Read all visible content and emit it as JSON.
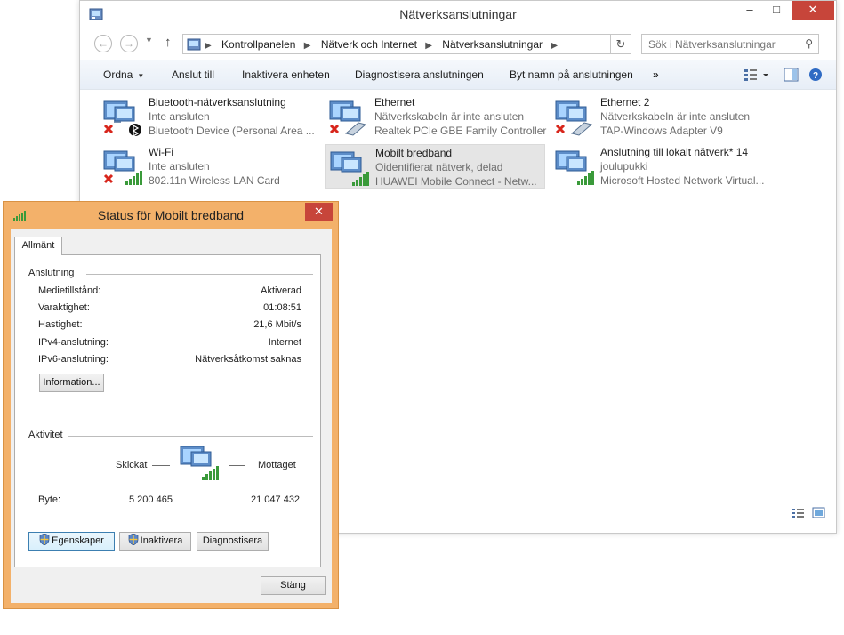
{
  "main_window": {
    "title": "Nätverksanslutningar",
    "caption": {
      "minimize": "–",
      "maximize": "□",
      "close": "✕"
    },
    "breadcrumbs": [
      "Kontrollpanelen",
      "Nätverk och Internet",
      "Nätverksanslutningar"
    ],
    "search_placeholder": "Sök i Nätverksanslutningar",
    "toolbar": {
      "organize": "Ordna",
      "connect_to": "Anslut till",
      "disable": "Inaktivera enheten",
      "diagnose": "Diagnostisera anslutningen",
      "rename": "Byt namn på anslutningen",
      "more": "»"
    },
    "adapters": [
      {
        "name": "Bluetooth-nätverksanslutning",
        "status": "Inte ansluten",
        "device": "Bluetooth Device (Personal Area ...",
        "icon": "bluetooth-network-icon",
        "badge": "bluetooth"
      },
      {
        "name": "Ethernet",
        "status": "Nätverkskabeln är inte ansluten",
        "device": "Realtek PCIe GBE Family Controller",
        "icon": "ethernet-network-icon",
        "badge": "cable"
      },
      {
        "name": "Ethernet 2",
        "status": "Nätverkskabeln är inte ansluten",
        "device": "TAP-Windows Adapter V9",
        "icon": "ethernet-network-icon",
        "badge": "cable"
      },
      {
        "name": "Wi-Fi",
        "status": "Inte ansluten",
        "device": "802.11n Wireless LAN Card",
        "icon": "wifi-network-icon",
        "badge": "signal"
      },
      {
        "name": "Mobilt bredband",
        "status": "Oidentifierat nätverk, delad",
        "device": "HUAWEI Mobile Connect - Netw...",
        "icon": "mobile-broadband-icon",
        "badge": "signal"
      },
      {
        "name": "Anslutning till lokalt nätverk* 14",
        "status": "joulupukki",
        "device": "Microsoft Hosted Network Virtual...",
        "icon": "hosted-network-icon",
        "badge": "signal"
      }
    ]
  },
  "dialog": {
    "title": "Status för Mobilt bredband",
    "close": "✕",
    "tab": "Allmänt",
    "connection_group": "Anslutning",
    "rows": [
      {
        "key": "Medietillstånd:",
        "value": "Aktiverad"
      },
      {
        "key": "Varaktighet:",
        "value": "01:08:51"
      },
      {
        "key": "Hastighet:",
        "value": "21,6 Mbit/s"
      },
      {
        "key": "IPv4-anslutning:",
        "value": "Internet"
      },
      {
        "key": "IPv6-anslutning:",
        "value": "Nätverksåtkomst saknas"
      }
    ],
    "info_button": "Information...",
    "activity_group": "Aktivitet",
    "sent_label": "Skickat",
    "received_label": "Mottaget",
    "bytes_label": "Byte:",
    "bytes_sent": "5 200 465",
    "bytes_received": "21 047 432",
    "properties_button": "Egenskaper",
    "disable_button": "Inaktivera",
    "diagnose_button": "Diagnostisera",
    "close_button": "Stäng"
  },
  "colors": {
    "dialog_frame": "#f3b16a",
    "close_red": "#c7453a",
    "signal_green": "#3a9a3a",
    "error_red": "#d8261c"
  }
}
